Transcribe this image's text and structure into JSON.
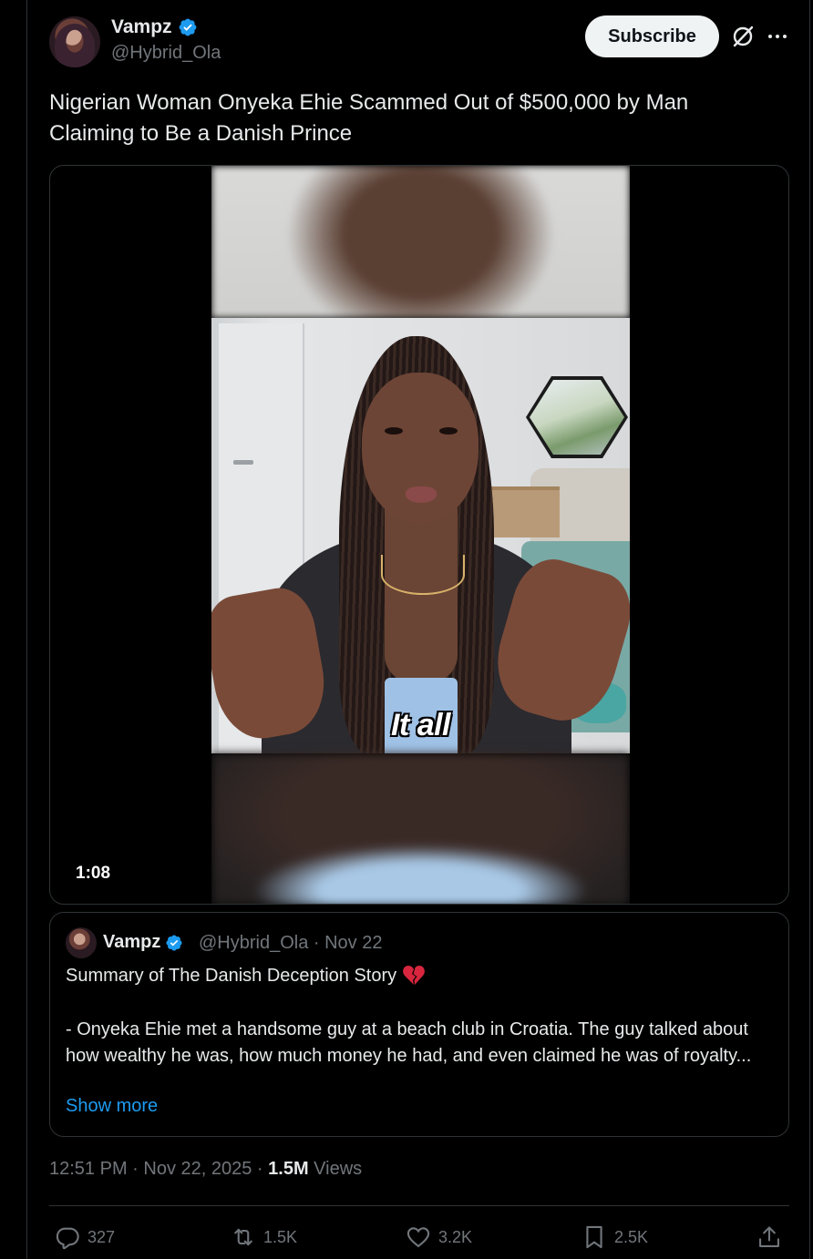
{
  "tweet": {
    "author_name": "Vampz",
    "author_handle": "@Hybrid_Ola",
    "subscribe_label": "Subscribe",
    "text": "Nigerian Woman Onyeka Ehie Scammed Out of $500,000 by Man Claiming to Be a Danish Prince",
    "video": {
      "caption": "It all",
      "duration": "1:08"
    },
    "timestamp": "12:51 PM · Nov 22, 2025 · ",
    "views_count": "1.5M",
    "views_label": " Views"
  },
  "quoted": {
    "author_name": "Vampz",
    "meta": "@Hybrid_Ola · Nov 22",
    "title": "Summary of The Danish Deception Story",
    "body": "- Onyeka Ehie met a handsome guy at a beach club in Croatia. The guy talked about how wealthy he was, how much money he had, and even claimed he was of royalty...",
    "show_more": "Show more"
  },
  "actions": {
    "replies": "327",
    "reposts": "1.5K",
    "likes": "3.2K",
    "bookmarks": "2.5K"
  },
  "icons": [
    "verified-badge-icon",
    "grok-icon",
    "more-icon",
    "broken-heart-icon",
    "reply-icon",
    "repost-icon",
    "like-icon",
    "bookmark-icon",
    "share-icon"
  ],
  "colors": {
    "background": "#000000",
    "text": "#e7e9ea",
    "muted": "#71767b",
    "accent": "#1d9bf0",
    "border": "#2f3336"
  }
}
